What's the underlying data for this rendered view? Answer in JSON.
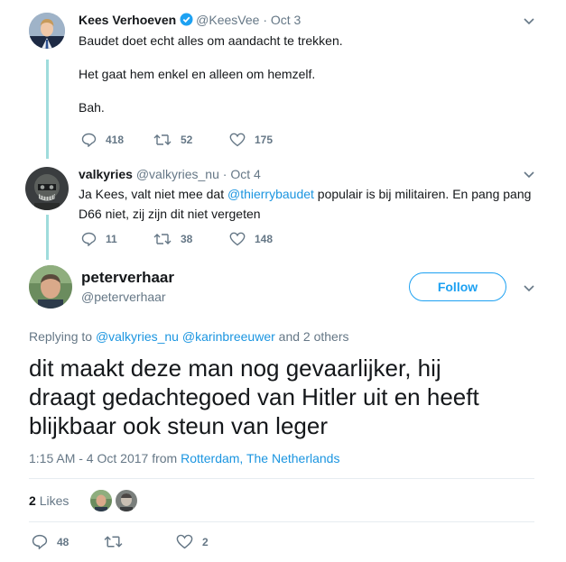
{
  "tweet1": {
    "name": "Kees Verhoeven",
    "handle": "@KeesVee",
    "date": "Oct 3",
    "lines": [
      "Baudet doet echt alles om aandacht te trekken.",
      "Het gaat hem enkel en alleen om hemzelf.",
      "Bah."
    ],
    "replies": "418",
    "retweets": "52",
    "likes": "175"
  },
  "tweet2": {
    "name": "valkyries",
    "handle": "@valkyries_nu",
    "date": "Oct 4",
    "line1_pre": "Ja Kees, valt niet mee dat ",
    "line1_mention": "@thierrybaudet",
    "line1_post": " populair is bij militairen. En pang pang",
    "line2": "D66 niet, zij zijn dit niet vergeten",
    "replies": "11",
    "retweets": "38",
    "likes": "148"
  },
  "main": {
    "name": "peterverhaar",
    "handle": "@peterverhaar",
    "follow_label": "Follow",
    "replying_prefix": "Replying to ",
    "replying_mention1": "@valkyries_nu",
    "replying_mention2": "@karinbreeuwer",
    "replying_suffix": " and 2 others",
    "text_lines": [
      "dit maakt deze man nog gevaarlijker, hij",
      "draagt gedachtegoed van Hitler uit en heeft",
      "blijkbaar ook steun van leger"
    ],
    "time": "1:15 AM - 4 Oct 2017",
    "from_label": "from",
    "location": "Rotterdam, The Netherlands",
    "likes_count": "2",
    "likes_label": "Likes",
    "replies": "48",
    "retweets": "",
    "likes": "2"
  },
  "colors": {
    "accent": "#1da1f2",
    "link": "#1b95e0",
    "meta": "#657786",
    "thread": "#9fdcdc"
  },
  "icons": [
    "verified-badge-icon",
    "chevron-down-icon",
    "reply-icon",
    "retweet-icon",
    "heart-icon"
  ]
}
